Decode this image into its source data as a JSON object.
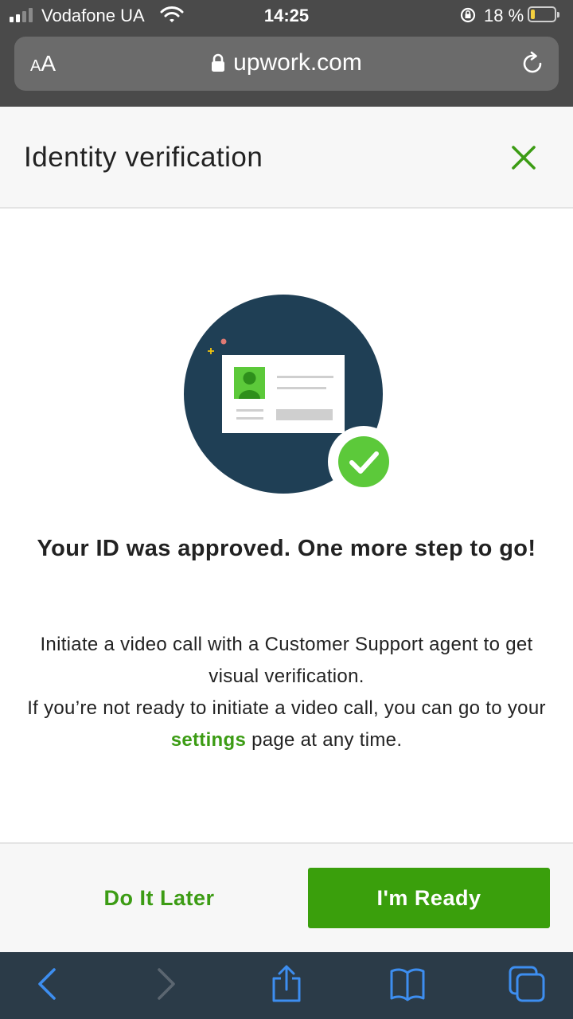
{
  "status_bar": {
    "carrier": "Vodafone UA",
    "time": "14:25",
    "battery_percent": "18 %",
    "battery_level": 0.18,
    "icons": [
      "signal-icon",
      "wifi-icon",
      "orientation-lock-icon",
      "battery-icon"
    ]
  },
  "address_bar": {
    "text_size_label": "AA",
    "url": "upwork.com",
    "icons": [
      "lock-icon",
      "reload-icon"
    ]
  },
  "modal": {
    "title": "Identity verification",
    "close_icon": "close-icon"
  },
  "content": {
    "illustration_icon": "id-card-approved-icon",
    "headline": "Your ID was approved. One more step to go!",
    "body_line1": "Initiate a video call with a Customer Support agent to get visual verification.",
    "body_line2_before": "If you’re not ready to initiate a video call, you can go to your ",
    "body_link": "settings",
    "body_line2_after": " page at any time."
  },
  "footer": {
    "later_label": "Do It Later",
    "ready_label": "I'm Ready"
  },
  "toolbar": {
    "icons": [
      "back-icon",
      "forward-icon",
      "share-icon",
      "bookmarks-icon",
      "tabs-icon"
    ]
  },
  "colors": {
    "brand_green": "#3a9f0c",
    "link_green": "#3c9c14",
    "illustration_navy": "#1f3f55",
    "toolbar_bg": "#2b3b48",
    "toolbar_icon": "#3d8ef0"
  }
}
